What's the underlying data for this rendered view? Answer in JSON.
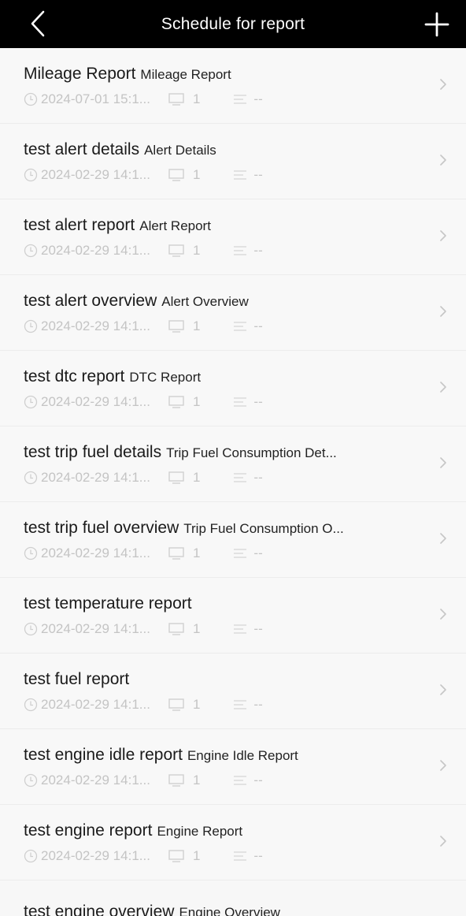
{
  "header": {
    "title": "Schedule for report"
  },
  "reports": [
    {
      "name": "Mileage Report",
      "type": "Mileage Report",
      "time": "2024-07-01 15:1...",
      "count": "1",
      "schedule": "--"
    },
    {
      "name": "test alert details",
      "type": "Alert Details",
      "time": "2024-02-29 14:1...",
      "count": "1",
      "schedule": "--"
    },
    {
      "name": "test alert report",
      "type": "Alert Report",
      "time": "2024-02-29 14:1...",
      "count": "1",
      "schedule": "--"
    },
    {
      "name": "test alert overview",
      "type": "Alert Overview",
      "time": "2024-02-29 14:1...",
      "count": "1",
      "schedule": "--"
    },
    {
      "name": "test dtc report",
      "type": "DTC Report",
      "time": "2024-02-29 14:1...",
      "count": "1",
      "schedule": "--"
    },
    {
      "name": "test trip fuel details",
      "type": "Trip Fuel Consumption Det...",
      "time": "2024-02-29 14:1...",
      "count": "1",
      "schedule": "--"
    },
    {
      "name": "test trip fuel overview",
      "type": "Trip Fuel Consumption O...",
      "time": "2024-02-29 14:1...",
      "count": "1",
      "schedule": "--"
    },
    {
      "name": "test temperature report",
      "type": "",
      "time": "2024-02-29 14:1...",
      "count": "1",
      "schedule": "--"
    },
    {
      "name": "test  fuel report",
      "type": "",
      "time": "2024-02-29 14:1...",
      "count": "1",
      "schedule": "--"
    },
    {
      "name": "test engine idle report",
      "type": "Engine Idle Report",
      "time": "2024-02-29 14:1...",
      "count": "1",
      "schedule": "--"
    },
    {
      "name": "test engine report",
      "type": "Engine Report",
      "time": "2024-02-29 14:1...",
      "count": "1",
      "schedule": "--"
    }
  ],
  "partial_row": {
    "name": "test engine overview",
    "type": "Engine Overview"
  },
  "icons": {
    "back": "chevron-left-icon",
    "add": "plus-icon",
    "time": "clock-icon",
    "device": "monitor-icon",
    "schedule": "schedule-icon",
    "row_arrow": "chevron-right-icon"
  }
}
